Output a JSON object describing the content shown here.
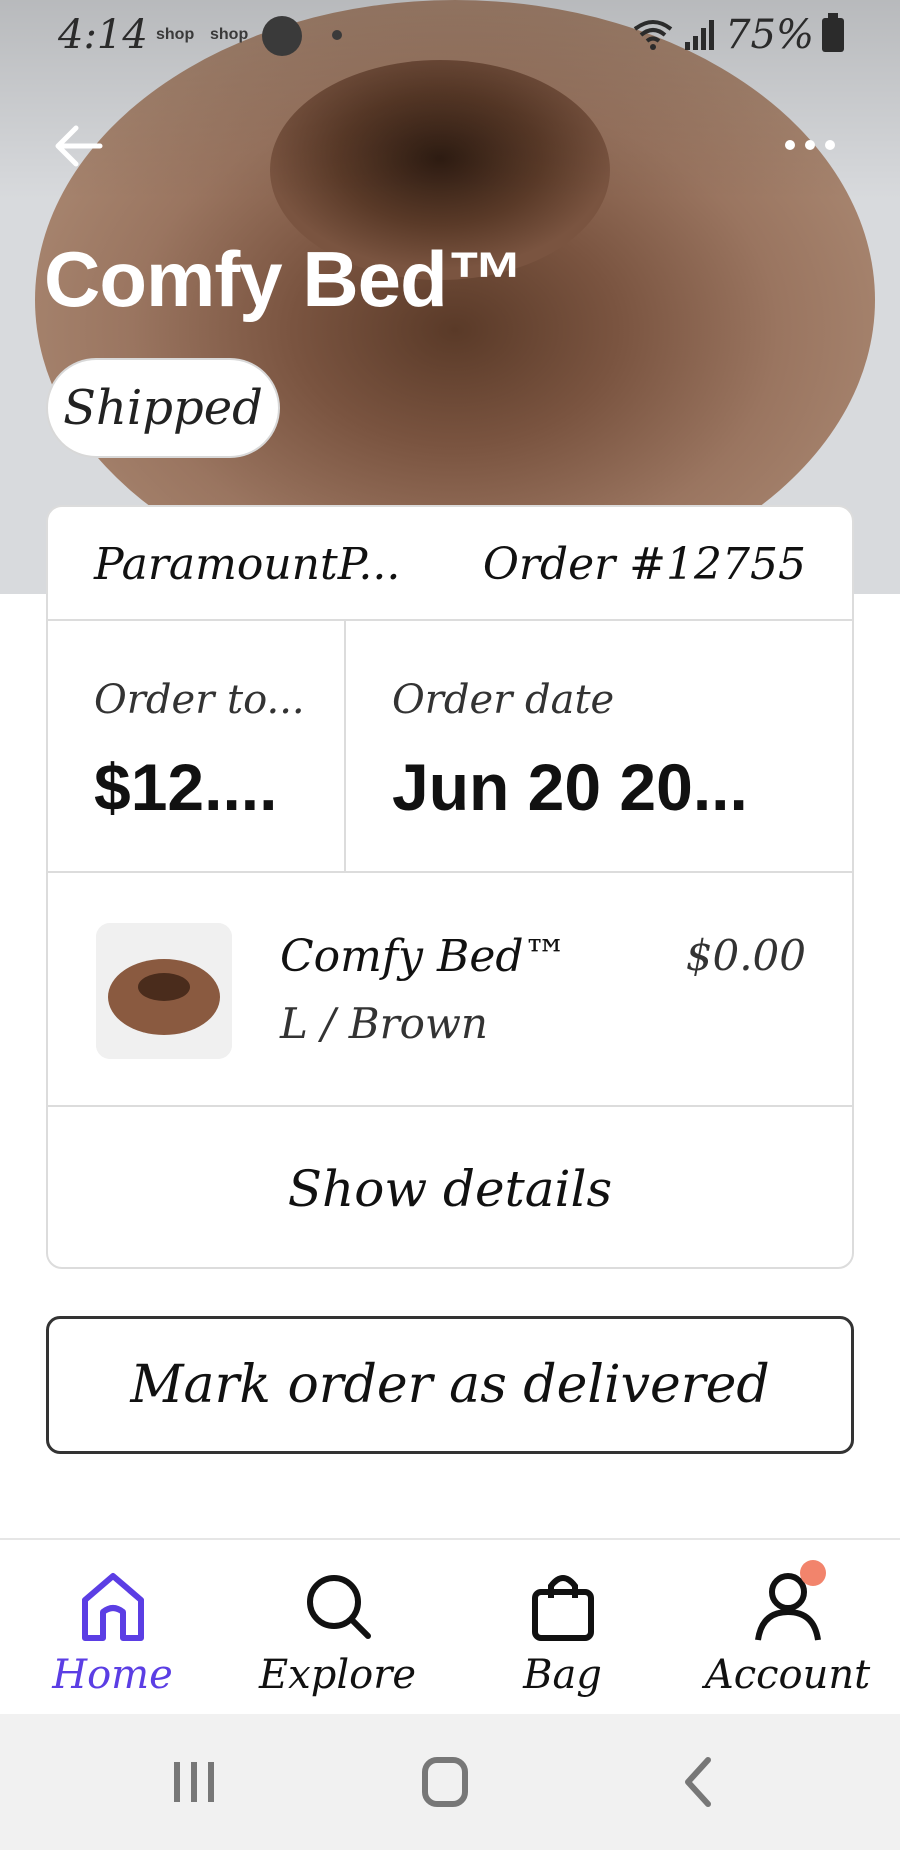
{
  "status_bar": {
    "time": "4:14",
    "notif_1": "shop",
    "notif_2": "shop",
    "battery": "75%"
  },
  "header": {
    "title": "Comfy Bed™",
    "status_badge": "Shipped"
  },
  "order": {
    "merchant": "ParamountP...",
    "order_number": "Order #12755",
    "total_label": "Order to...",
    "total_value": "$12....",
    "date_label": "Order date",
    "date_value": "Jun 20 20...",
    "item": {
      "name": "Comfy Bed™",
      "variant": "L / Brown",
      "price": "$0.00"
    },
    "show_details_label": "Show details"
  },
  "actions": {
    "mark_delivered_label": "Mark order as delivered"
  },
  "bottom_nav": {
    "items": [
      {
        "label": "Home",
        "icon": "home-icon",
        "active": true
      },
      {
        "label": "Explore",
        "icon": "search-icon",
        "active": false
      },
      {
        "label": "Bag",
        "icon": "bag-icon",
        "active": false
      },
      {
        "label": "Account",
        "icon": "account-icon",
        "active": false
      }
    ]
  },
  "colors": {
    "accent": "#5b3ee4",
    "notification_badge": "#f2846c",
    "card_border": "#dcdcdc"
  }
}
